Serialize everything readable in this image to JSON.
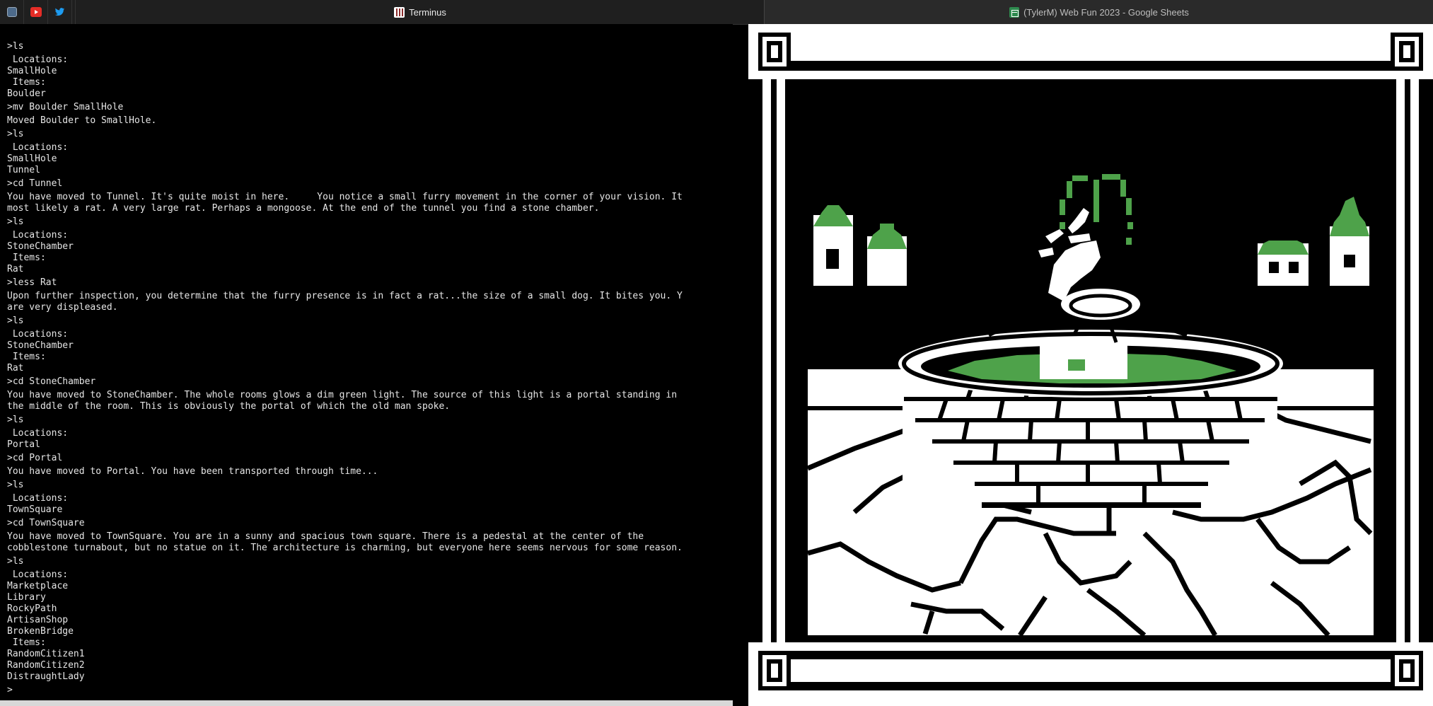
{
  "tabs": {
    "pinned": [
      {
        "name": "app-icon"
      },
      {
        "name": "youtube-icon"
      },
      {
        "name": "twitter-icon"
      }
    ],
    "active_title": "Terminus",
    "other_title": "(TylerM) Web Fun 2023 - Google Sheets"
  },
  "terminal": {
    "lines": [
      {
        "kind": "cmd",
        "text": ">ls"
      },
      {
        "kind": "out",
        "text": " Locations:\nSmallHole\n Items:\nBoulder"
      },
      {
        "kind": "cmd",
        "text": ">mv Boulder SmallHole"
      },
      {
        "kind": "out",
        "text": "Moved Boulder to SmallHole."
      },
      {
        "kind": "cmd",
        "text": ">ls"
      },
      {
        "kind": "out",
        "text": " Locations:\nSmallHole\nTunnel"
      },
      {
        "kind": "cmd",
        "text": ">cd Tunnel"
      },
      {
        "kind": "out",
        "text": "You have moved to Tunnel. It's quite moist in here.     You notice a small furry movement in the corner of your vision. It\nmost likely a rat. A very large rat. Perhaps a mongoose. At the end of the tunnel you find a stone chamber."
      },
      {
        "kind": "cmd",
        "text": ">ls"
      },
      {
        "kind": "out",
        "text": " Locations:\nStoneChamber\n Items:\nRat"
      },
      {
        "kind": "cmd",
        "text": ">less Rat"
      },
      {
        "kind": "out",
        "text": "Upon further inspection, you determine that the furry presence is in fact a rat...the size of a small dog. It bites you. Y\nare very displeased."
      },
      {
        "kind": "cmd",
        "text": ">ls"
      },
      {
        "kind": "out",
        "text": " Locations:\nStoneChamber\n Items:\nRat"
      },
      {
        "kind": "cmd",
        "text": ">cd StoneChamber"
      },
      {
        "kind": "out",
        "text": "You have moved to StoneChamber. The whole rooms glows a dim green light. The source of this light is a portal standing in\nthe middle of the room. This is obviously the portal of which the old man spoke."
      },
      {
        "kind": "cmd",
        "text": ">ls"
      },
      {
        "kind": "out",
        "text": " Locations:\nPortal"
      },
      {
        "kind": "cmd",
        "text": ">cd Portal"
      },
      {
        "kind": "out",
        "text": "You have moved to Portal. You have been transported through time..."
      },
      {
        "kind": "cmd",
        "text": ">ls"
      },
      {
        "kind": "out",
        "text": " Locations:\nTownSquare"
      },
      {
        "kind": "cmd",
        "text": ">cd TownSquare"
      },
      {
        "kind": "out",
        "text": "You have moved to TownSquare. You are in a sunny and spacious town square. There is a pedestal at the center of the\ncobblestone turnabout, but no statue on it. The architecture is charming, but everyone here seems nervous for some reason."
      },
      {
        "kind": "cmd",
        "text": ">ls"
      },
      {
        "kind": "out",
        "text": " Locations:\nMarketplace\nLibrary\nRockyPath\nArtisanShop\nBrokenBridge\n Items:\nRandomCitizen1\nRandomCitizen2\nDistraughtLady"
      },
      {
        "kind": "prompt",
        "text": ">"
      }
    ]
  },
  "colors": {
    "green": "#4ea24a",
    "white": "#ffffff",
    "background": "#000000"
  }
}
